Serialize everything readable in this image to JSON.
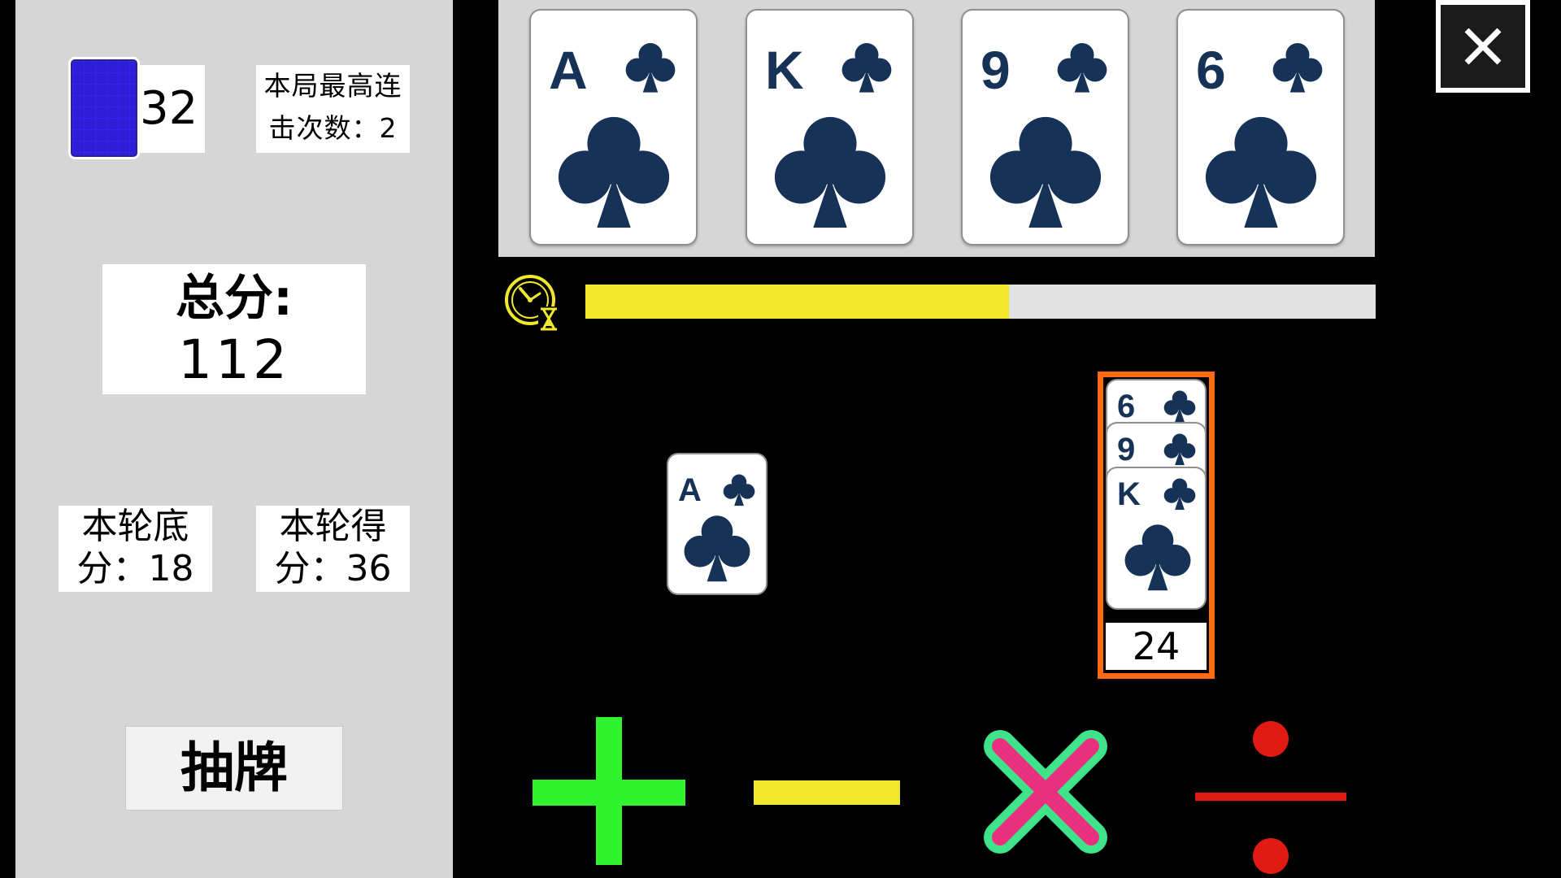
{
  "deck": {
    "remaining": "32",
    "icon": "card-back"
  },
  "stats": {
    "best_combo_line1": "本局最高连",
    "best_combo_line2": "击次数：2",
    "total_label": "总分:",
    "total_value": "112",
    "round_base_line1": "本轮底",
    "round_base_line2": "分：18",
    "round_gain_line1": "本轮得",
    "round_gain_line2": "分：36"
  },
  "draw_button": {
    "label": "抽牌"
  },
  "tray_cards": [
    {
      "rank": "A",
      "suit": "clubs"
    },
    {
      "rank": "K",
      "suit": "clubs"
    },
    {
      "rank": "9",
      "suit": "clubs"
    },
    {
      "rank": "6",
      "suit": "clubs"
    }
  ],
  "timer": {
    "icon": "clock-hourglass-icon",
    "progress": 0.536,
    "fill_color": "#f2e82b"
  },
  "played_card": {
    "rank": "A",
    "suit": "clubs"
  },
  "stack": {
    "cards": [
      {
        "rank": "6",
        "suit": "clubs"
      },
      {
        "rank": "9",
        "suit": "clubs"
      },
      {
        "rank": "K",
        "suit": "clubs"
      }
    ],
    "score": "24",
    "border_color": "#ff6a12"
  },
  "operators": [
    {
      "name": "plus",
      "color": "#2ff32f"
    },
    {
      "name": "minus",
      "color": "#f2e82b"
    },
    {
      "name": "multiply",
      "color": "#e8307e",
      "outline": "#3ee38a"
    },
    {
      "name": "divide",
      "color": "#e21b12"
    }
  ],
  "colors": {
    "suit": "#163256",
    "panel": "#d6d6d6"
  }
}
